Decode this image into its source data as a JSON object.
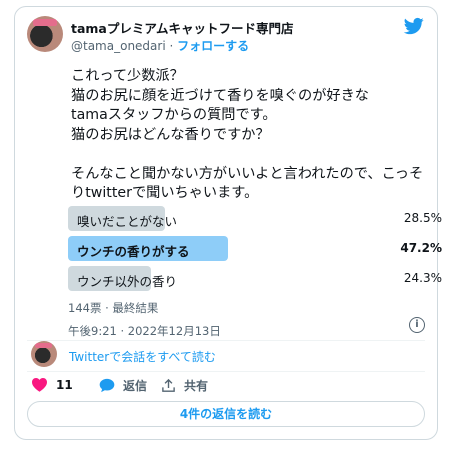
{
  "account": {
    "name": "tamaプレミアムキャットフード専門店",
    "handle": "@tama_onedari",
    "separator": "·",
    "follow_label": "フォローする"
  },
  "tweet": {
    "text": "これって少数派？\n猫のお尻に顔を近づけて香りを嗅ぐのが好きな\ntamaスタッフからの質問です。\n猫のお尻はどんな香りですか？\n\nそんなこと聞かない方がいいよと言われたので、こっそりtwitterで聞いちゃいます。"
  },
  "poll": {
    "options": [
      {
        "label": "嗅いだことがない",
        "percent": "28.5%",
        "fraction": 0.285,
        "winner": false
      },
      {
        "label": "ウンチの香りがする",
        "percent": "47.2%",
        "fraction": 0.472,
        "winner": true
      },
      {
        "label": "ウンチ以外の香り",
        "percent": "24.3%",
        "fraction": 0.243,
        "winner": false
      }
    ],
    "summary": "144票 · 最終結果"
  },
  "timestamp": "午後9:21 · 2022年12月13日",
  "conversation_link": "Twitterで会話をすべて読む",
  "actions": {
    "like_count": "11",
    "reply_label": "返信",
    "share_label": "共有"
  },
  "read_replies_label": "4件の返信を読む",
  "colors": {
    "accent": "#1d9bf0",
    "like": "#f91880",
    "poll_winner": "#8ecdf8",
    "poll_bar": "#cfd9de"
  },
  "icons": [
    "twitter-bird-icon",
    "info-icon",
    "heart-icon",
    "reply-bubble-icon",
    "share-icon"
  ]
}
